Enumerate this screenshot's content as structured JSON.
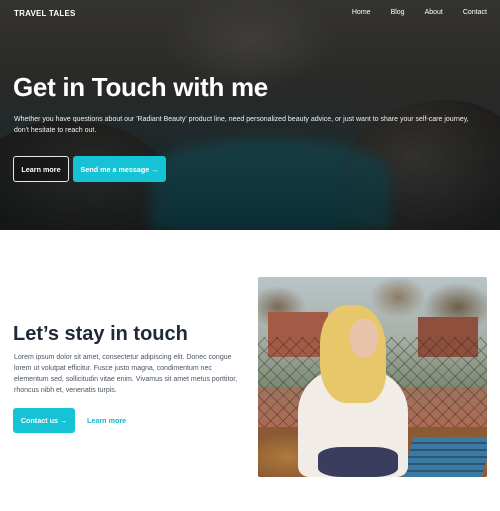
{
  "brand": "TRAVEL TALES",
  "nav": {
    "items": [
      "Home",
      "Blog",
      "About",
      "Contact"
    ]
  },
  "hero": {
    "title": "Get in Touch with me",
    "text": "Whether you have questions about our 'Radiant Beauty' product line, need personalized beauty advice, or just want to share your self-care journey, don't hesitate to reach out.",
    "learn_more": "Learn more",
    "send_message": "Send me a message →"
  },
  "contact": {
    "title": "Let’s stay in touch",
    "text": "Lorem ipsum dolor sit amet, consectetur adipiscing elit. Donec congue lorem ut volutpat efficitur. Fusce justo magna, condimentum nec elementum sed, sollicitudin vitae enim. Vivamus sit amet metus porttitor, rhoncus nibh et, venenatis turpis.",
    "contact_us": "Contact us →",
    "learn_more": "Learn more"
  },
  "colors": {
    "accent": "#16c2d5",
    "link": "#15b6cc",
    "heading": "#1f2937"
  }
}
